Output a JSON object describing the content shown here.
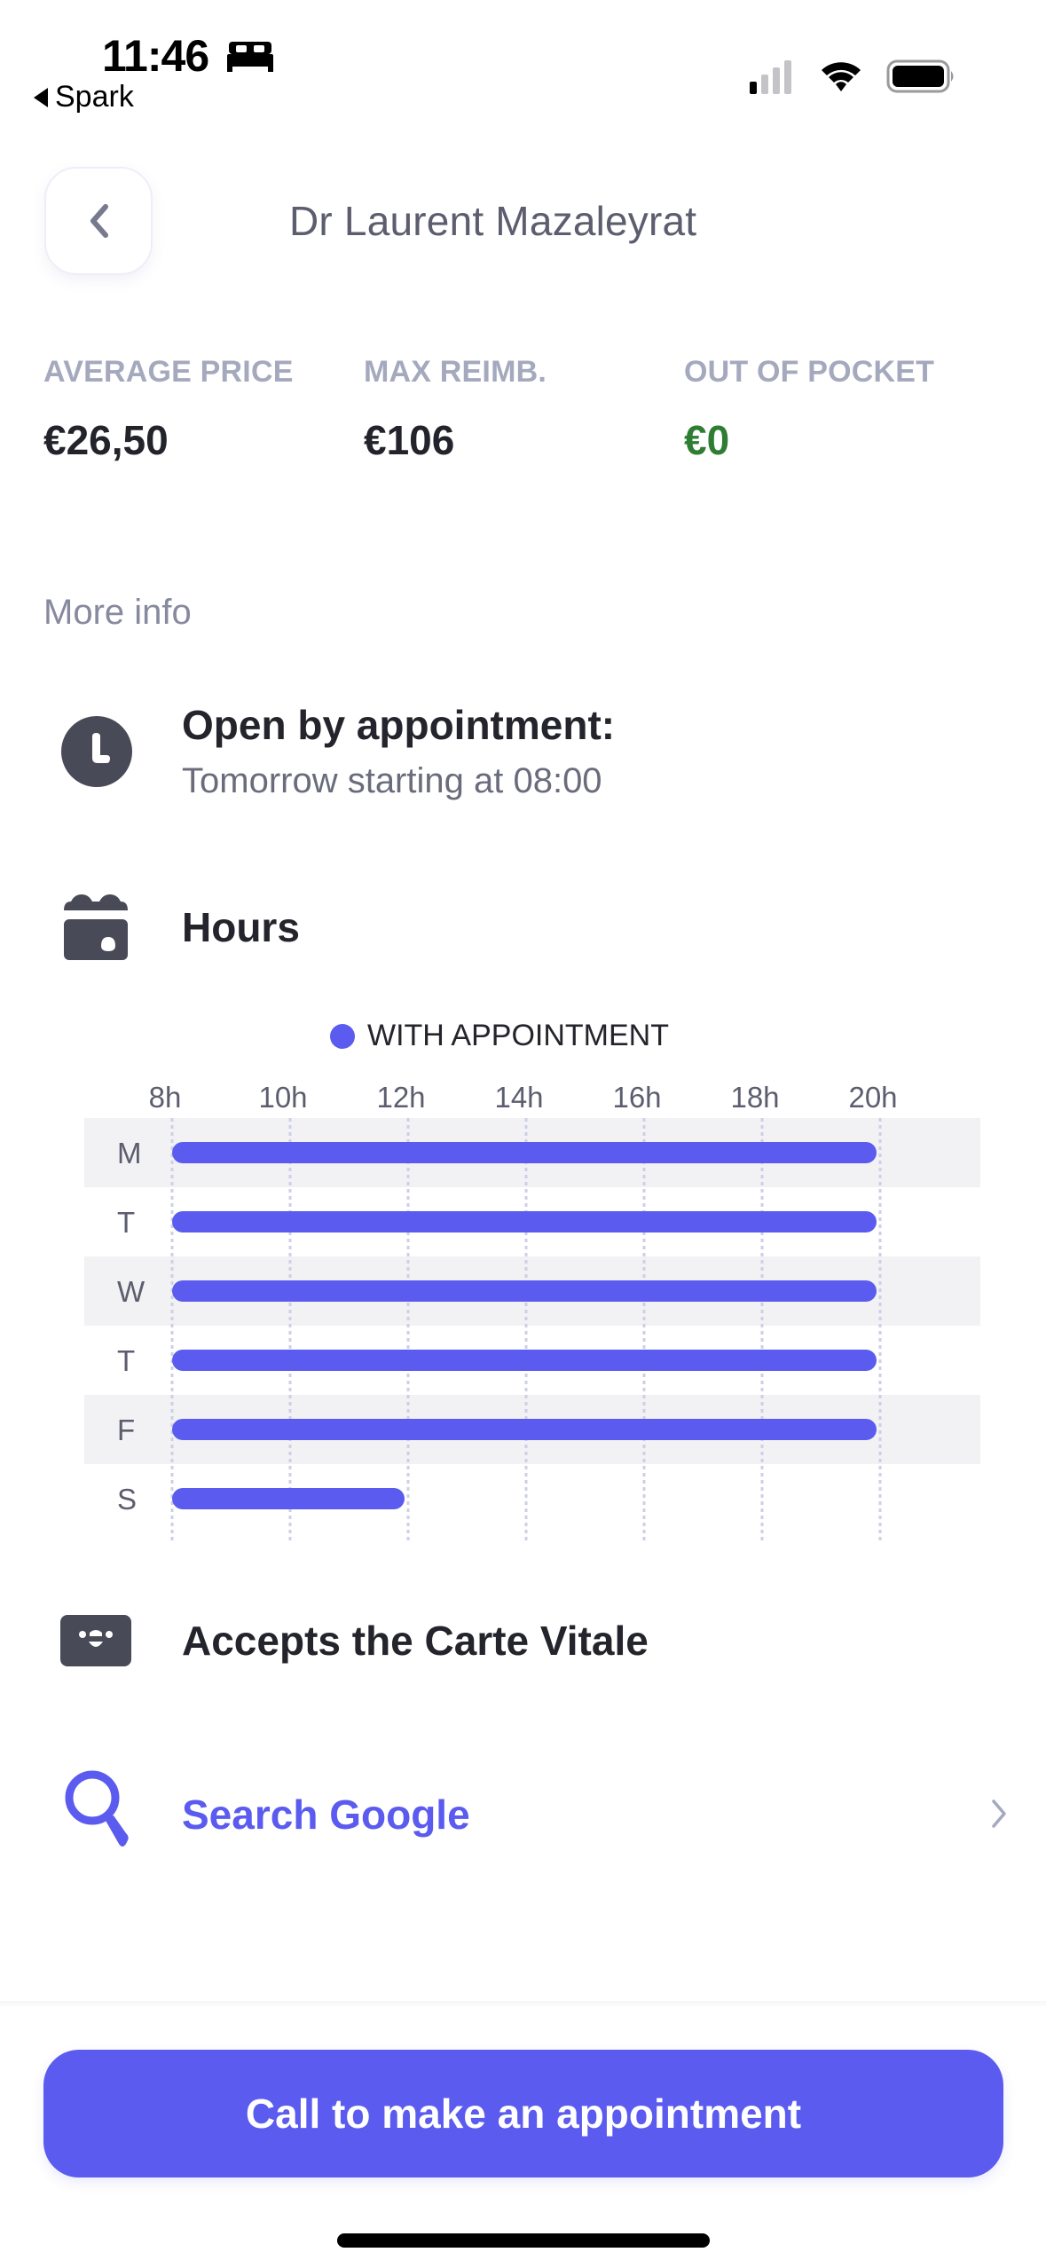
{
  "status_bar": {
    "time": "11:46",
    "focus_icon": "bed-icon",
    "back_app": "Spark",
    "signal_bars_active": 1,
    "signal_bars_total": 4,
    "wifi_icon": "wifi-icon",
    "battery_icon": "battery-icon"
  },
  "header": {
    "back_icon": "chevron-left-icon",
    "title": "Dr Laurent Mazaleyrat"
  },
  "stats": [
    {
      "label": "AVERAGE PRICE",
      "value": "€26,50",
      "color": "#22232b"
    },
    {
      "label": "MAX REIMB.",
      "value": "€106",
      "color": "#22232b"
    },
    {
      "label": "OUT OF POCKET",
      "value": "€0",
      "color": "#2e7d32"
    }
  ],
  "more_info": {
    "heading": "More info",
    "appointment": {
      "icon": "clock-icon",
      "title": "Open by appointment:",
      "subtitle": "Tomorrow starting at 08:00"
    },
    "hours": {
      "icon": "calendar-icon",
      "title": "Hours"
    },
    "carte_vitale": {
      "icon": "carte-vitale-icon",
      "title": "Accepts the Carte Vitale"
    },
    "search": {
      "icon": "search-icon",
      "label": "Search Google",
      "chevron": "chevron-right-icon"
    }
  },
  "chart_data": {
    "type": "bar",
    "orientation": "horizontal-range",
    "title": "",
    "legend": [
      {
        "label": "WITH APPOINTMENT",
        "color": "#5b5bef"
      }
    ],
    "legend_position": "top-center",
    "x_ticks": [
      "8h",
      "10h",
      "12h",
      "14h",
      "16h",
      "18h",
      "20h"
    ],
    "xlim": [
      8,
      20
    ],
    "grid": true,
    "categories": [
      "M",
      "T",
      "W",
      "T",
      "F",
      "S"
    ],
    "series": [
      {
        "name": "WITH APPOINTMENT",
        "ranges": [
          [
            8,
            20
          ],
          [
            8,
            20
          ],
          [
            8,
            20
          ],
          [
            8,
            20
          ],
          [
            8,
            20
          ],
          [
            8,
            12
          ]
        ]
      }
    ]
  },
  "cta": {
    "label": "Call to make an appointment"
  },
  "colors": {
    "accent": "#5b5bef",
    "text_dark": "#24242c",
    "text_muted": "#a4a9bd",
    "positive": "#2e7d32",
    "icon_dark": "#484a57"
  }
}
